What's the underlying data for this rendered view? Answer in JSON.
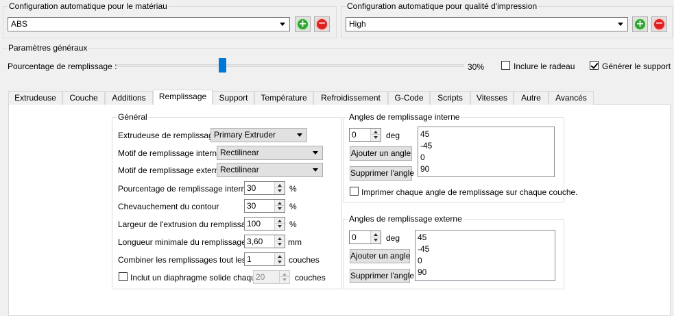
{
  "material": {
    "title": "Configuration automatique pour le matériau",
    "selected": "ABS",
    "add_icon": "plus-circle-icon",
    "remove_icon": "minus-circle-icon"
  },
  "quality": {
    "title": "Configuration automatique pour qualité d'impression",
    "selected": "High"
  },
  "general_params": {
    "title": "Paramètres généraux",
    "infill_label": "Pourcentage de remplissage :",
    "infill_value": "30%",
    "infill_fraction": 0.3,
    "raft_label": "Inclure le radeau",
    "raft_checked": false,
    "support_label": "Générer le support",
    "support_checked": true
  },
  "tabs": [
    {
      "label": "Extrudeuse"
    },
    {
      "label": "Couche"
    },
    {
      "label": "Additions"
    },
    {
      "label": "Remplissage"
    },
    {
      "label": "Support"
    },
    {
      "label": "Température"
    },
    {
      "label": "Refroidissement"
    },
    {
      "label": "G-Code"
    },
    {
      "label": "Scripts"
    },
    {
      "label": "Vitesses"
    },
    {
      "label": "Autre"
    },
    {
      "label": "Avancés"
    }
  ],
  "active_tab": "Remplissage",
  "general": {
    "title": "Général",
    "infill_extruder_label": "Extrudeuse de remplissage",
    "infill_extruder_value": "Primary Extruder",
    "internal_pattern_label": "Motif de remplissage interne",
    "internal_pattern_value": "Rectilinear",
    "external_pattern_label": "Motif de remplissage externe",
    "external_pattern_value": "Rectilinear",
    "internal_pct_label": "Pourcentage de remplissage interne",
    "internal_pct_value": "30",
    "internal_pct_unit": "%",
    "overlap_label": "Chevauchement du contour",
    "overlap_value": "30",
    "overlap_unit": "%",
    "extrusion_width_label": "Largeur de l'extrusion du remplissage",
    "extrusion_width_value": "100",
    "extrusion_width_unit": "%",
    "min_length_label": "Longueur minimale du remplissage",
    "min_length_value": "3,60",
    "min_length_unit": "mm",
    "combine_label": "Combiner les remplissages tout les",
    "combine_value": "1",
    "combine_unit": "couches",
    "diaphragm_label": "Inclut un diaphragme solide chaque",
    "diaphragm_checked": false,
    "diaphragm_value": "20",
    "diaphragm_unit": "couches"
  },
  "internal_angles": {
    "title": "Angles de remplissage interne",
    "input_value": "0",
    "unit": "deg",
    "add_label": "Ajouter un angle",
    "remove_label": "Supprimer l'angle",
    "angles": [
      "45",
      "-45",
      "0",
      "90"
    ],
    "print_each_label": "Imprimer chaque angle de remplissage sur chaque couche.",
    "print_each_checked": false
  },
  "external_angles": {
    "title": "Angles de remplissage externe",
    "input_value": "0",
    "unit": "deg",
    "add_label": "Ajouter un angle",
    "remove_label": "Supprimer l'angle",
    "angles": [
      "45",
      "-45",
      "0",
      "90"
    ]
  }
}
